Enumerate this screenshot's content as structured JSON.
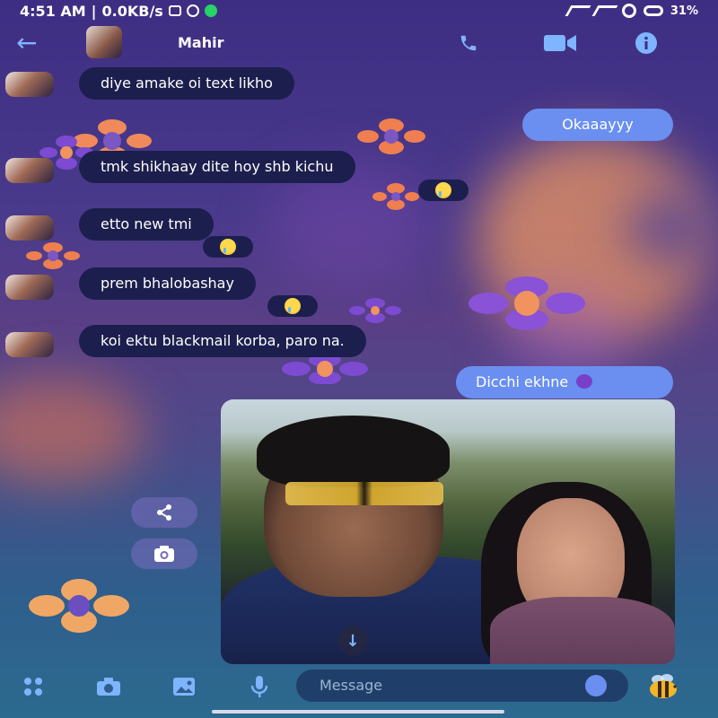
{
  "status_bar": {
    "time": "4:51 AM",
    "network": "0.0KB/s",
    "battery": "31%"
  },
  "header": {
    "contact_name": "Mahir"
  },
  "messages": [
    {
      "direction": "in",
      "text": "diye amake oi text likho"
    },
    {
      "direction": "out",
      "text": "Okaaayyy"
    },
    {
      "direction": "in",
      "text": "tmk shikhaay dite hoy shb kichu",
      "reaction": "sad-tear-emoji"
    },
    {
      "direction": "in",
      "text": "etto new tmi",
      "reaction": "sad-tear-emoji"
    },
    {
      "direction": "in",
      "text": "prem bhalobashay",
      "reaction": "sad-tear-emoji"
    },
    {
      "direction": "in",
      "text": "koi ektu blackmail korba, paro na."
    },
    {
      "direction": "out",
      "text": "Dicchi ekhne",
      "emoji": "smiling-devil-emoji"
    },
    {
      "direction": "out",
      "type": "photo"
    }
  ],
  "composer": {
    "placeholder": "Message"
  },
  "colors": {
    "accent": "#7fb4ff",
    "bubble_out": "#6a8ff0",
    "bubble_in": "#1c1f4d"
  },
  "icons": [
    "back-arrow-icon",
    "phone-icon",
    "video-call-icon",
    "info-icon",
    "share-icon",
    "camera-icon",
    "menu-dots-icon",
    "image-icon",
    "microphone-icon",
    "emoji-icon",
    "bee-sticker-icon",
    "arrow-down-icon"
  ]
}
